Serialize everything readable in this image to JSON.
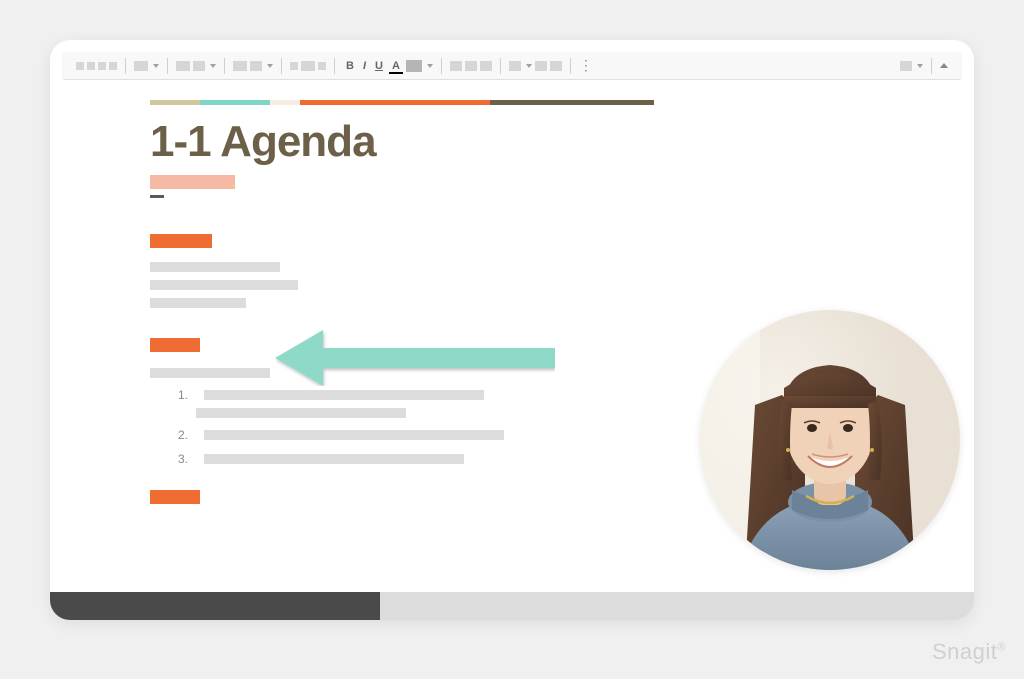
{
  "toolbar": {
    "bold_label": "B",
    "italic_label": "I",
    "underline_label": "U",
    "font_color_label": "A",
    "more_label": "⋮"
  },
  "document": {
    "title": "1-1 Agenda",
    "list": {
      "item1_num": "1.",
      "item2_num": "2.",
      "item3_num": "3."
    },
    "stripe_colors": [
      "#d0c89a",
      "#7ed6c6",
      "#f5eee0",
      "#ef6c33",
      "#6d6048"
    ],
    "highlight_color": "#f7b9a3",
    "accent_color": "#ef6c33"
  },
  "annotations": {
    "arrow_color": "#8fd9c9"
  },
  "watermark": {
    "text": "Snagit",
    "symbol": "®"
  }
}
